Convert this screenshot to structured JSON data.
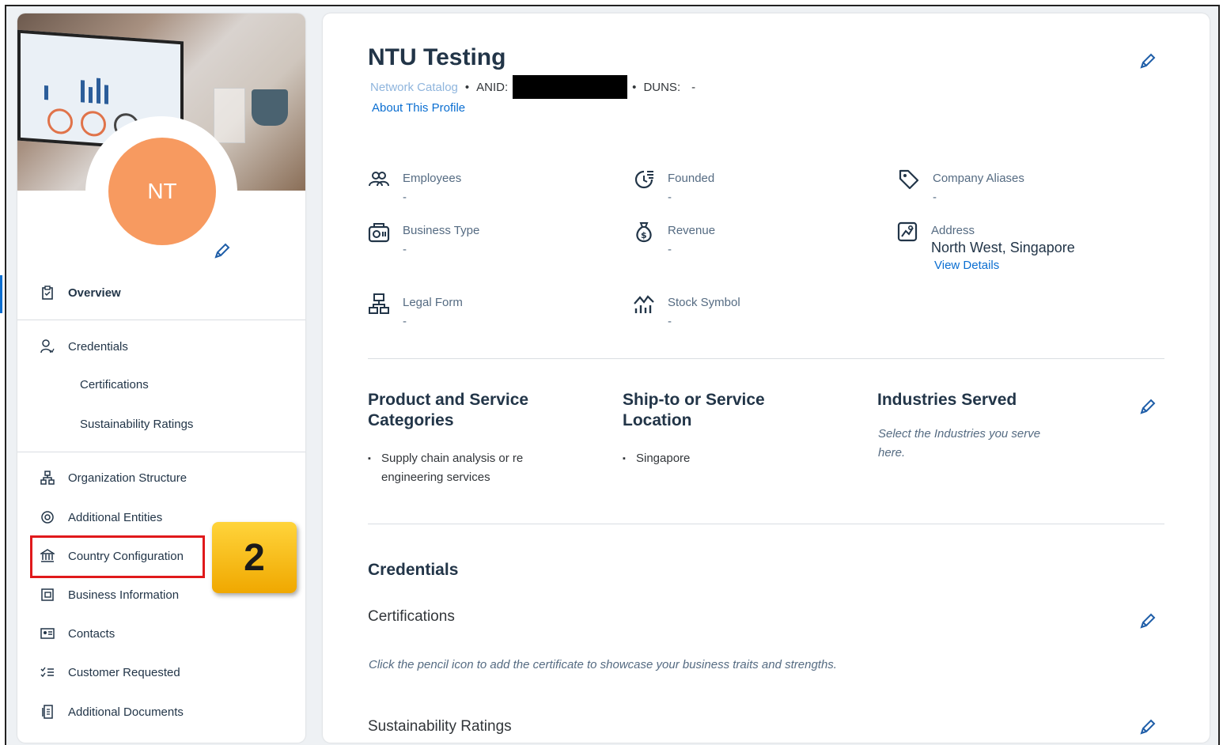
{
  "profile": {
    "initials": "NT",
    "name": "NTU Testing",
    "catalog_label": "Network Catalog",
    "anid_label": "ANID:",
    "duns_label": "DUNS:",
    "duns_value": "-",
    "about_link": "About This Profile"
  },
  "sidebar": {
    "overview": "Overview",
    "credentials": "Credentials",
    "certifications": "Certifications",
    "sustainability": "Sustainability Ratings",
    "org_structure": "Organization Structure",
    "additional_entities": "Additional Entities",
    "country_config": "Country Configuration",
    "business_info": "Business Information",
    "contacts": "Contacts",
    "customer_requested": "Customer Requested",
    "additional_documents": "Additional Documents"
  },
  "annotation": {
    "step": "2",
    "highlight_color": "#e0191b"
  },
  "fields": {
    "employees": {
      "label": "Employees",
      "value": "-"
    },
    "founded": {
      "label": "Founded",
      "value": "-"
    },
    "aliases": {
      "label": "Company Aliases",
      "value": "-"
    },
    "business_type": {
      "label": "Business Type",
      "value": "-"
    },
    "revenue": {
      "label": "Revenue",
      "value": "-"
    },
    "address": {
      "label": "Address",
      "value": "North West, Singapore",
      "link": "View Details"
    },
    "legal_form": {
      "label": "Legal Form",
      "value": "-"
    },
    "stock": {
      "label": "Stock Symbol",
      "value": "-"
    }
  },
  "sections": {
    "products": {
      "title_line1": "Product and Service",
      "title_line2": "Categories",
      "item_line1": "Supply chain analysis or re",
      "item_line2": "engineering services"
    },
    "shipto": {
      "title_line1": "Ship-to or Service",
      "title_line2": "Location",
      "item": "Singapore"
    },
    "industries": {
      "title": "Industries Served",
      "hint_line1": "Select the Industries you serve",
      "hint_line2": "here."
    },
    "credentials": {
      "title": "Credentials",
      "certifications": "Certifications",
      "cert_hint": "Click the pencil icon to add the certificate to showcase your business traits and strengths.",
      "sustainability": "Sustainability Ratings"
    }
  },
  "colors": {
    "accent": "#0a6ed1",
    "avatar": "#f79a60",
    "text": "#223548"
  }
}
